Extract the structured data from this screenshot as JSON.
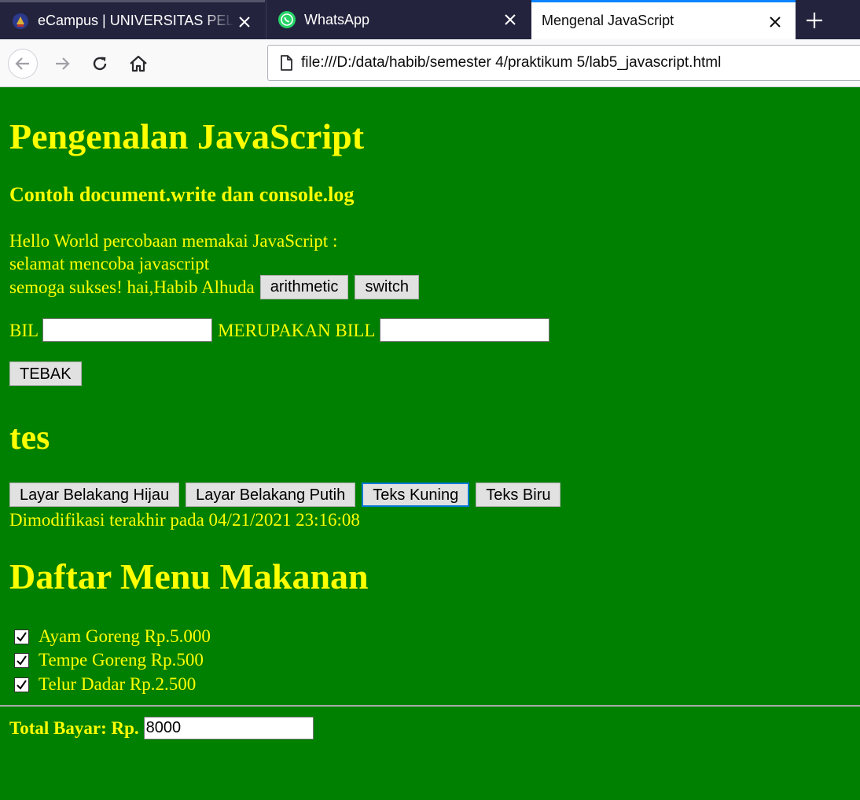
{
  "browser": {
    "tabs": [
      {
        "title": "eCampus | UNIVERSITAS PELITA",
        "favicon": "university-crest-icon",
        "active": false
      },
      {
        "title": "WhatsApp",
        "favicon": "whatsapp-icon",
        "active": false
      },
      {
        "title": "Mengenal JavaScript",
        "favicon": "",
        "active": true
      }
    ],
    "url": "file:///D:/data/habib/semester 4/praktikum 5/lab5_javascript.html",
    "colors": {
      "tabbar": "#23233e",
      "active_tab_accent": "#0a84ff",
      "toolbar": "#f9f9fa"
    }
  },
  "page": {
    "background": "#008000",
    "text_color": "#ffff00",
    "heading_main": "Pengenalan JavaScript",
    "subheading": "Contoh document.write dan console.log",
    "line1": "Hello World percobaan memakai JavaScript :",
    "line2": "selamat mencoba javascript",
    "line3": "semoga sukses! hai,Habib Alhuda",
    "arithmetic_button": "arithmetic",
    "switch_button": "switch",
    "bil_label": "BIL",
    "bil_value": "",
    "merupakan_label": "MERUPAKAN BILL",
    "merupakan_value": "",
    "tebak_button": "TEBAK",
    "heading_tes": "tes",
    "color_buttons": [
      {
        "label": "Layar Belakang Hijau"
      },
      {
        "label": "Layar Belakang Putih"
      },
      {
        "label": "Teks Kuning"
      },
      {
        "label": "Teks Biru"
      }
    ],
    "modified_text": "Dimodifikasi terakhir pada 04/21/2021 23:16:08",
    "menu_heading": "Daftar Menu Makanan",
    "menu_items": [
      {
        "label": "Ayam Goreng Rp.5.000",
        "checked": true
      },
      {
        "label": "Tempe Goreng Rp.500",
        "checked": true
      },
      {
        "label": "Telur Dadar Rp.2.500",
        "checked": true
      }
    ],
    "total_label": "Total Bayar: Rp.",
    "total_value": "8000"
  }
}
